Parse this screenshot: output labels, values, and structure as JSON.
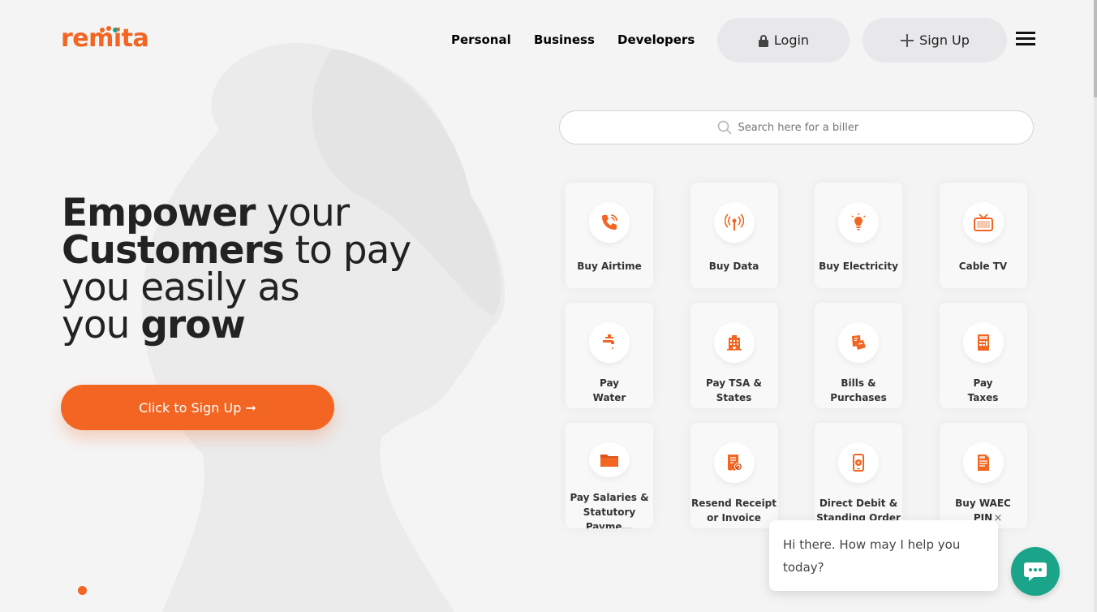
{
  "header": {
    "logo_text": "remita",
    "nav": [
      "Personal",
      "Business",
      "Developers"
    ],
    "login_label": "Login",
    "signup_label": "Sign Up"
  },
  "hero": {
    "line1_bold": "Empower",
    "line1_light": " your",
    "line2_bold": "Customers",
    "line2_light": " to pay",
    "line3_light": "you easily as",
    "line4_light": "you ",
    "line4_bold": "grow",
    "cta_label": "Click to Sign Up ➞"
  },
  "search": {
    "placeholder": "Search here for a biller"
  },
  "services": [
    {
      "label": "Buy Airtime",
      "icon": "phone-icon"
    },
    {
      "label": "Buy Data",
      "icon": "signal-icon"
    },
    {
      "label": "Buy Electricity",
      "icon": "bulb-icon"
    },
    {
      "label": "Cable TV",
      "icon": "tv-icon"
    },
    {
      "label": "Pay\nWater",
      "icon": "tap-icon"
    },
    {
      "label": "Pay TSA &\nStates",
      "icon": "building-icon"
    },
    {
      "label": "Bills &\nPurchases",
      "icon": "bill-icon"
    },
    {
      "label": "Pay\nTaxes",
      "icon": "tax-icon"
    },
    {
      "label": "Pay Salaries &\nStatutory Payme...",
      "icon": "folder-icon"
    },
    {
      "label": "Resend Receipt\nor Invoice",
      "icon": "receipt-icon"
    },
    {
      "label": "Direct Debit &\nStanding Order",
      "icon": "mobile-debit-icon"
    },
    {
      "label": "Buy WAEC\nPIN",
      "icon": "waec-icon"
    }
  ],
  "chat": {
    "message": "Hi there. How may I help you today?",
    "close": "×"
  },
  "colors": {
    "brand": "#f26522",
    "chat": "#1aa58a",
    "background": "#f4f4f4"
  }
}
